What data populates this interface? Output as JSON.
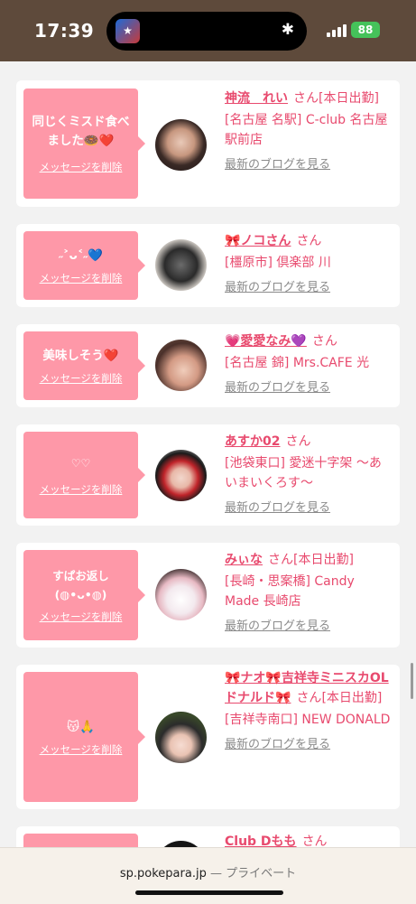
{
  "status_bar": {
    "time": "17:39",
    "battery": "88"
  },
  "browser": {
    "domain": "sp.pokepara.jp",
    "separator": " — ",
    "privacy_label": "プライベート"
  },
  "delete_label": "メッセージを削除",
  "blog_label": "最新のブログを見る",
  "san_label": "さん",
  "entries": [
    {
      "message": "同じくミスド食べました🍩❤️",
      "name": "神流　れい",
      "suffix": "[本日出勤]",
      "location": "[名古屋 名駅] C-club 名古屋駅前店"
    },
    {
      "message": "˶˃ᴗ˂˶💙",
      "name": "🎀ノコさん",
      "suffix": "",
      "location": "[橿原市] 倶楽部 川"
    },
    {
      "message": "美味しそう❤️",
      "name": "💗愛愛なみ💜",
      "suffix": "",
      "location": "[名古屋 錦] Mrs.CAFE 光"
    },
    {
      "message": "♡♡",
      "name": "あすか02",
      "suffix": "",
      "location": "[池袋東口] 愛迷十字架 〜あいまいくろす〜"
    },
    {
      "message": "すぱお返し(⁠◍⁠•⁠ᴗ⁠•⁠◍⁠)",
      "name": "みぃな",
      "suffix": "[本日出勤]",
      "location": "[長崎・思案橋] Candy Made 長崎店"
    },
    {
      "message": "😽🙏",
      "name": "🎀ナオ🎀吉祥寺ミニスカOLドナルド🎀",
      "suffix": "[本日出勤]",
      "location": "[吉祥寺南口] NEW DONALD"
    },
    {
      "message": "",
      "name": "Club Dもも",
      "suffix": "",
      "location": ""
    }
  ],
  "colors": {
    "accent": "#e84a6e",
    "bubble": "#fe98a8",
    "status_bar": "#5e4a3b"
  }
}
